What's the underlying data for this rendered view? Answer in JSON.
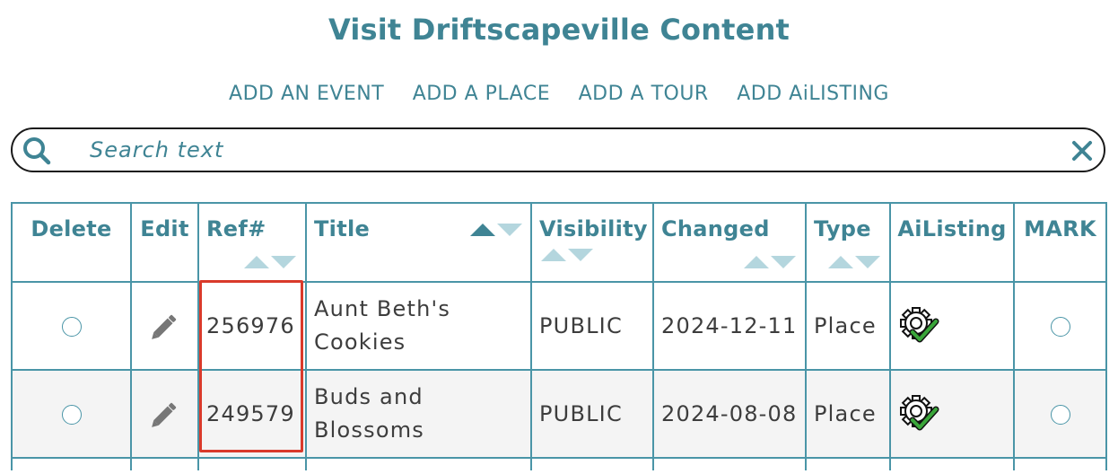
{
  "page": {
    "title": "Visit Driftscapeville Content"
  },
  "actions": [
    {
      "label": "ADD AN EVENT"
    },
    {
      "label": "ADD A PLACE"
    },
    {
      "label": "ADD A TOUR"
    },
    {
      "label": "ADD AiLISTING"
    }
  ],
  "search": {
    "placeholder": "Search text",
    "value": ""
  },
  "table": {
    "columns": [
      {
        "label": "Delete"
      },
      {
        "label": "Edit"
      },
      {
        "label": "Ref#"
      },
      {
        "label": "Title"
      },
      {
        "label": "Visibility"
      },
      {
        "label": "Changed"
      },
      {
        "label": "Type"
      },
      {
        "label": "AiListing"
      },
      {
        "label": "MARK"
      }
    ],
    "rows": [
      {
        "ref": "256976",
        "title_line1": "Aunt Beth's",
        "title_line2": "Cookies",
        "visibility": "PUBLIC",
        "changed": "2024-12-11",
        "type": "Place"
      },
      {
        "ref": "249579",
        "title_line1": "Buds and",
        "title_line2": "Blossoms",
        "visibility": "PUBLIC",
        "changed": "2024-08-08",
        "type": "Place"
      }
    ]
  },
  "icons": {
    "search": "search-icon",
    "clear": "close-icon",
    "edit": "pencil-icon",
    "ailisting": "gear-check-icon"
  },
  "colors": {
    "accent": "#3f8494",
    "border": "#4a95a7",
    "sort_inactive": "#b4d6de",
    "highlight": "#d93a2b",
    "check": "#3aa63a"
  }
}
